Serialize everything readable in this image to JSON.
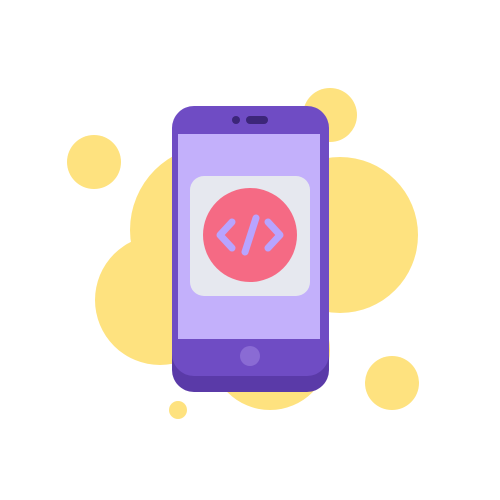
{
  "illustration": {
    "subject": "smartphone-with-code-app-icon",
    "icons": {
      "app": "code-icon",
      "home": "home-button-icon"
    },
    "colors": {
      "background": "#ffffff",
      "blob": "#fee27f",
      "phone_body": "#6f4cc4",
      "phone_body_shadow": "#5a3aa8",
      "phone_chin": "#5f3fb3",
      "screen": "#c3b0fb",
      "app_tile": "#e6e8ef",
      "app_circle": "#f56a84",
      "code_glyph": "#b8a4ff",
      "speaker": "#3c2679",
      "home_button": "#8a6bd4"
    }
  }
}
